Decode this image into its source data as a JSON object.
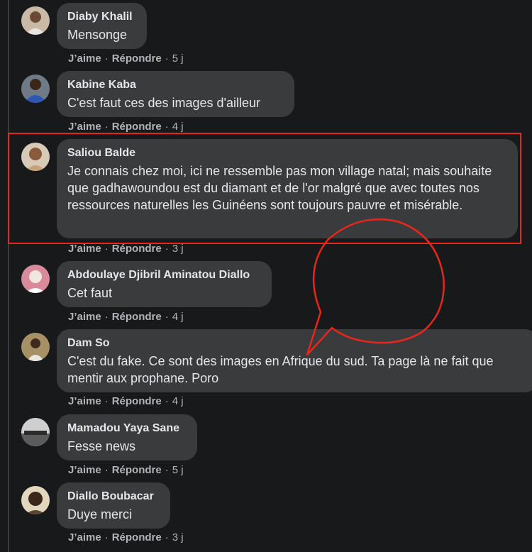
{
  "comments": [
    {
      "author": "Diaby Khalil",
      "text": "Mensonge",
      "like": "J’aime",
      "reply": "Répondre",
      "time": "5 j"
    },
    {
      "author": "Kabine Kaba",
      "text": "C'est faut ces des images d'ailleur",
      "like": "J’aime",
      "reply": "Répondre",
      "time": "4 j"
    },
    {
      "author": "Saliou Balde",
      "text": "Je connais chez moi, ici ne ressemble pas mon village natal; mais souhaite que gadhawoundou est du diamant et de l'or malgré que avec toutes nos ressources naturelles les Guinéens sont toujours pauvre et misérable.",
      "like": "J’aime",
      "reply": "Répondre",
      "time": "3 j"
    },
    {
      "author": "Abdoulaye Djibril Aminatou Diallo",
      "text": "Cet faut",
      "like": "J’aime",
      "reply": "Répondre",
      "time": "4 j"
    },
    {
      "author": "Dam So",
      "text": "C'est du fake. Ce sont des images en Afrique du sud. Ta page là ne fait que mentir aux prophane. Poro",
      "like": "J’aime",
      "reply": "Répondre",
      "time": "4 j"
    },
    {
      "author": "Mamadou Yaya Sane",
      "text": "Fesse news",
      "like": "J’aime",
      "reply": "Répondre",
      "time": "5 j"
    },
    {
      "author": "Diallo Boubacar",
      "text": "Duye merci",
      "like": "J’aime",
      "reply": "Répondre",
      "time": "3 j"
    }
  ],
  "colors": {
    "background": "#18191a",
    "bubble": "#3a3b3c",
    "text": "#e4e6eb",
    "meta": "#b0b3b8",
    "annotation": "#e8261b"
  }
}
